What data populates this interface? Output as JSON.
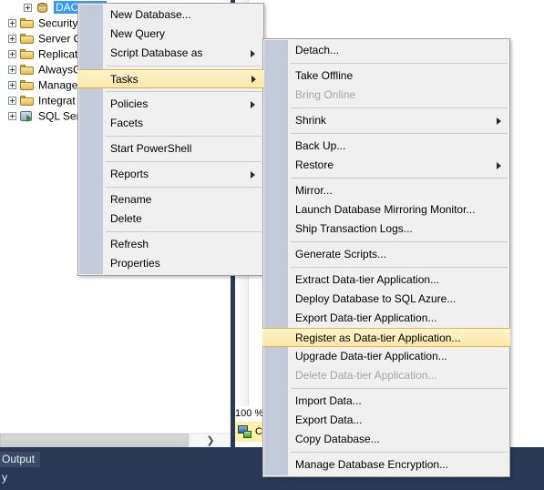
{
  "explorer": {
    "tree_items": [
      {
        "label": "DAC_Test",
        "icon": "database-icon",
        "selected": true,
        "indent": 26,
        "expander": true
      },
      {
        "label": "Security",
        "icon": "folder-icon",
        "selected": false,
        "indent": 9,
        "expander": true
      },
      {
        "label": "Server C",
        "icon": "folder-icon",
        "selected": false,
        "indent": 9,
        "expander": true
      },
      {
        "label": "Replicat",
        "icon": "folder-icon",
        "selected": false,
        "indent": 9,
        "expander": true
      },
      {
        "label": "AlwaysC",
        "icon": "folder-icon",
        "selected": false,
        "indent": 9,
        "expander": true
      },
      {
        "label": "Manage",
        "icon": "folder-icon",
        "selected": false,
        "indent": 9,
        "expander": true
      },
      {
        "label": "Integrat",
        "icon": "folder-icon",
        "selected": false,
        "indent": 9,
        "expander": true
      },
      {
        "label": "SQL Ser",
        "icon": "sql-agent-icon",
        "selected": false,
        "indent": 9,
        "expander": true
      }
    ]
  },
  "editor_status": {
    "zoom_level": "100 %",
    "connection_label": "C",
    "connection_icon": "connection-icon"
  },
  "scrollbar": {
    "right_arrow_glyph": "❯"
  },
  "bottom_dock": {
    "tab_label": "Output",
    "status_text": "y"
  },
  "context_menu": {
    "name": "database-context-menu",
    "items": [
      {
        "label": "New Database...",
        "type": "item"
      },
      {
        "label": "New Query",
        "type": "item"
      },
      {
        "label": "Script Database as",
        "type": "submenu"
      },
      {
        "type": "separator"
      },
      {
        "label": "Tasks",
        "type": "submenu",
        "highlight": true
      },
      {
        "type": "separator"
      },
      {
        "label": "Policies",
        "type": "submenu"
      },
      {
        "label": "Facets",
        "type": "item"
      },
      {
        "type": "separator"
      },
      {
        "label": "Start PowerShell",
        "type": "item"
      },
      {
        "type": "separator"
      },
      {
        "label": "Reports",
        "type": "submenu"
      },
      {
        "type": "separator"
      },
      {
        "label": "Rename",
        "type": "item"
      },
      {
        "label": "Delete",
        "type": "item"
      },
      {
        "type": "separator"
      },
      {
        "label": "Refresh",
        "type": "item"
      },
      {
        "label": "Properties",
        "type": "item"
      }
    ]
  },
  "tasks_submenu": {
    "name": "tasks-submenu",
    "items": [
      {
        "label": "Detach...",
        "type": "item"
      },
      {
        "type": "separator"
      },
      {
        "label": "Take Offline",
        "type": "item"
      },
      {
        "label": "Bring Online",
        "type": "item",
        "disabled": true
      },
      {
        "type": "separator"
      },
      {
        "label": "Shrink",
        "type": "submenu"
      },
      {
        "type": "separator"
      },
      {
        "label": "Back Up...",
        "type": "item"
      },
      {
        "label": "Restore",
        "type": "submenu"
      },
      {
        "type": "separator"
      },
      {
        "label": "Mirror...",
        "type": "item"
      },
      {
        "label": "Launch Database Mirroring Monitor...",
        "type": "item"
      },
      {
        "label": "Ship Transaction Logs...",
        "type": "item"
      },
      {
        "type": "separator"
      },
      {
        "label": "Generate Scripts...",
        "type": "item"
      },
      {
        "type": "separator"
      },
      {
        "label": "Extract Data-tier Application...",
        "type": "item"
      },
      {
        "label": "Deploy Database to SQL Azure...",
        "type": "item"
      },
      {
        "label": "Export Data-tier Application...",
        "type": "item"
      },
      {
        "label": "Register as Data-tier Application...",
        "type": "item",
        "highlight": true
      },
      {
        "label": "Upgrade Data-tier Application...",
        "type": "item"
      },
      {
        "label": "Delete Data-tier Application...",
        "type": "item",
        "disabled": true
      },
      {
        "type": "separator"
      },
      {
        "label": "Import Data...",
        "type": "item"
      },
      {
        "label": "Export Data...",
        "type": "item"
      },
      {
        "label": "Copy Database...",
        "type": "item"
      },
      {
        "type": "separator"
      },
      {
        "label": "Manage Database Encryption...",
        "type": "item"
      }
    ]
  },
  "colors": {
    "selection_blue": "#3399ff",
    "menu_bg": "#f0f0f0",
    "menu_gutter": "#c3cada",
    "highlight_top": "#fdf4cd",
    "highlight_bottom": "#fae7a8",
    "highlight_border": "#e0b84a",
    "dock_bg": "#293955",
    "splitter": "#2b3a55",
    "status_yellow": "#fbf2a8"
  }
}
